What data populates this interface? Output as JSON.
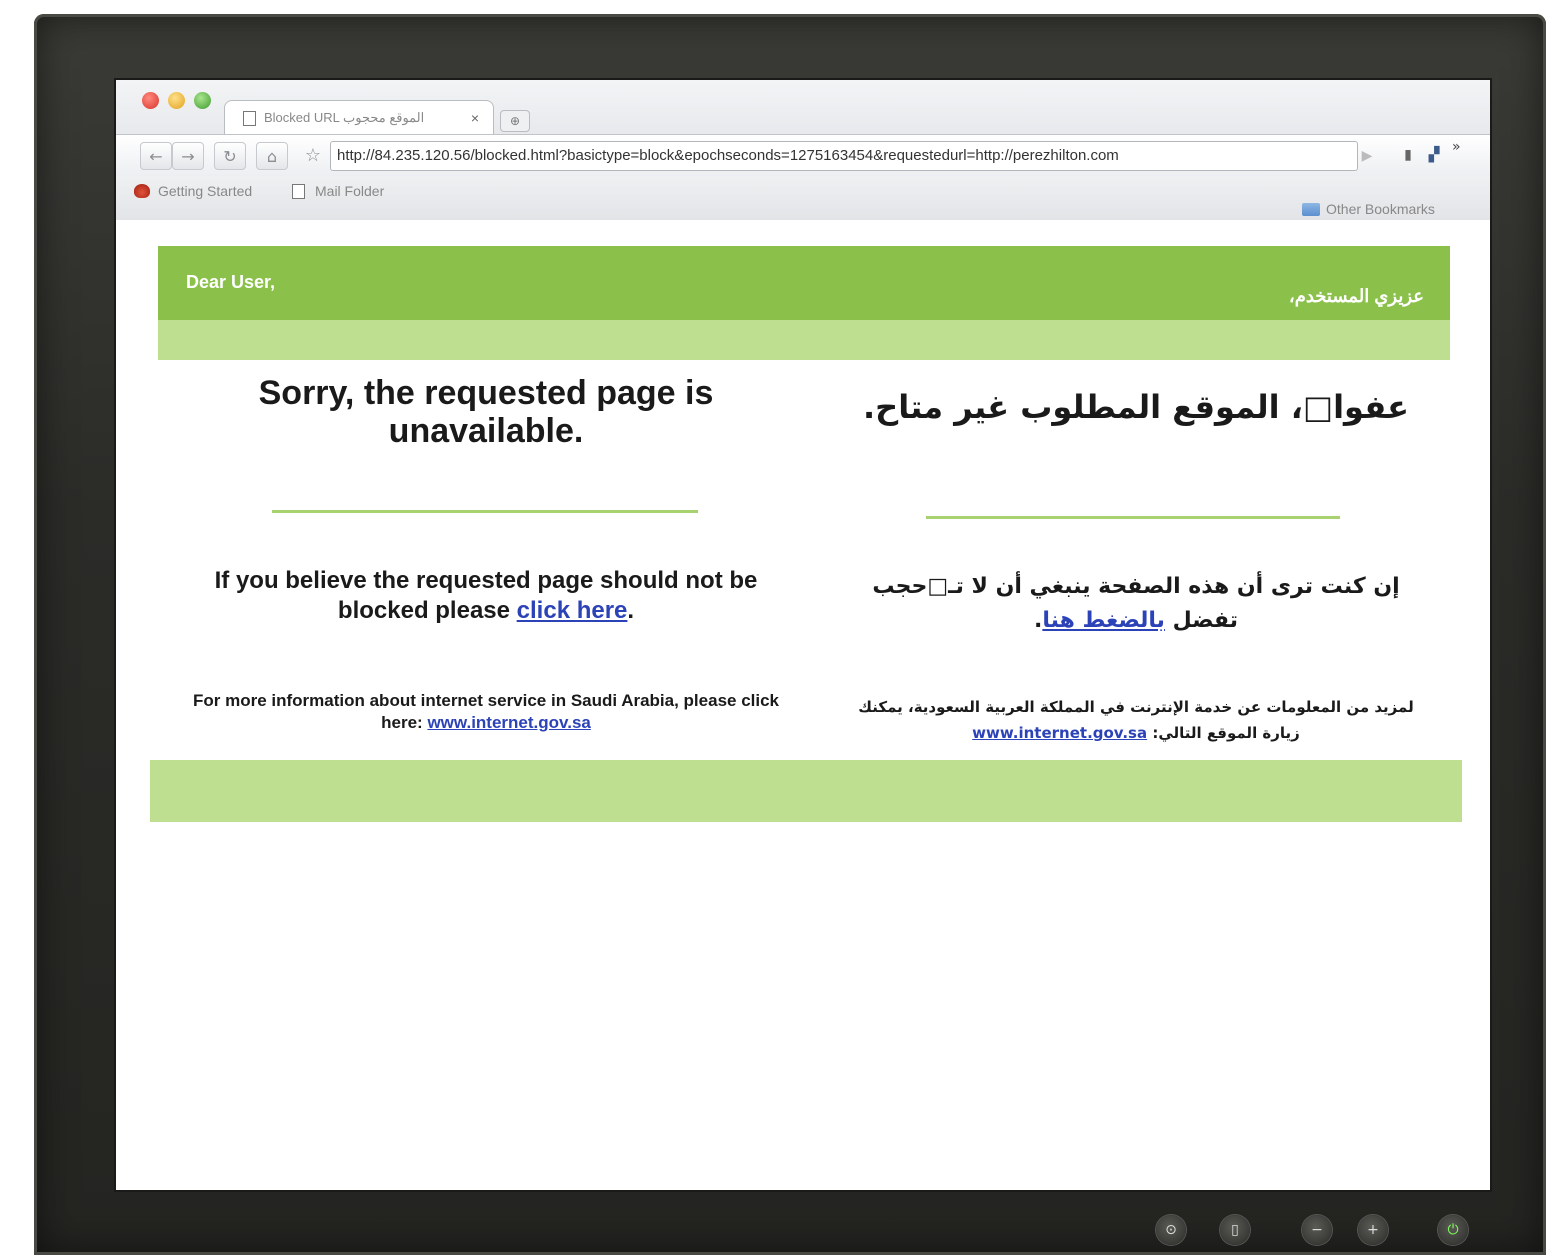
{
  "browser": {
    "tab_title": "Blocked URL الموقع محجوب",
    "tab_close": "×",
    "new_tab": "⊕",
    "url": "http://84.235.120.56/blocked.html?basictype=block&epochseconds=1275163454&requestedurl=http://perezhilton.com",
    "bookmarks": [
      {
        "label": "Getting Started"
      },
      {
        "label": "Mail Folder"
      }
    ],
    "other_bookmarks": "Other Bookmarks"
  },
  "page": {
    "greeting_en": "Dear User,",
    "greeting_ar": "عزيزي المستخدم،",
    "heading_en": "Sorry, the requested page is unavailable.",
    "heading_ar": "عفوا□، الموقع المطلوب غير متاح.",
    "unblock_en_prefix": "If you believe the requested page should not be blocked please ",
    "unblock_en_link": "click here",
    "unblock_en_suffix": ".",
    "unblock_ar_prefix": "إن كنت ترى أن هذه الصفحة ينبغي أن لا تـ□حجب تفضل ",
    "unblock_ar_link": "بالضغط هنا",
    "unblock_ar_suffix": ".",
    "info_en_prefix": "For more information about internet service in Saudi Arabia, please click here: ",
    "info_en_link": "www.internet.gov.sa",
    "info_ar_prefix": "لمزيد من المعلومات عن خدمة الإنترنت في المملكة العربية السعودية، يمكنك زيارة الموقع التالي: ",
    "info_ar_link": "www.internet.gov.sa"
  },
  "colors": {
    "banner_green": "#8bc14b",
    "light_green": "#bddf8f",
    "link_blue": "#2c43b8"
  },
  "icons": {
    "back": "arrow-left-icon",
    "forward": "arrow-right-icon",
    "reload": "reload-icon",
    "home": "home-icon",
    "star": "star-icon"
  }
}
